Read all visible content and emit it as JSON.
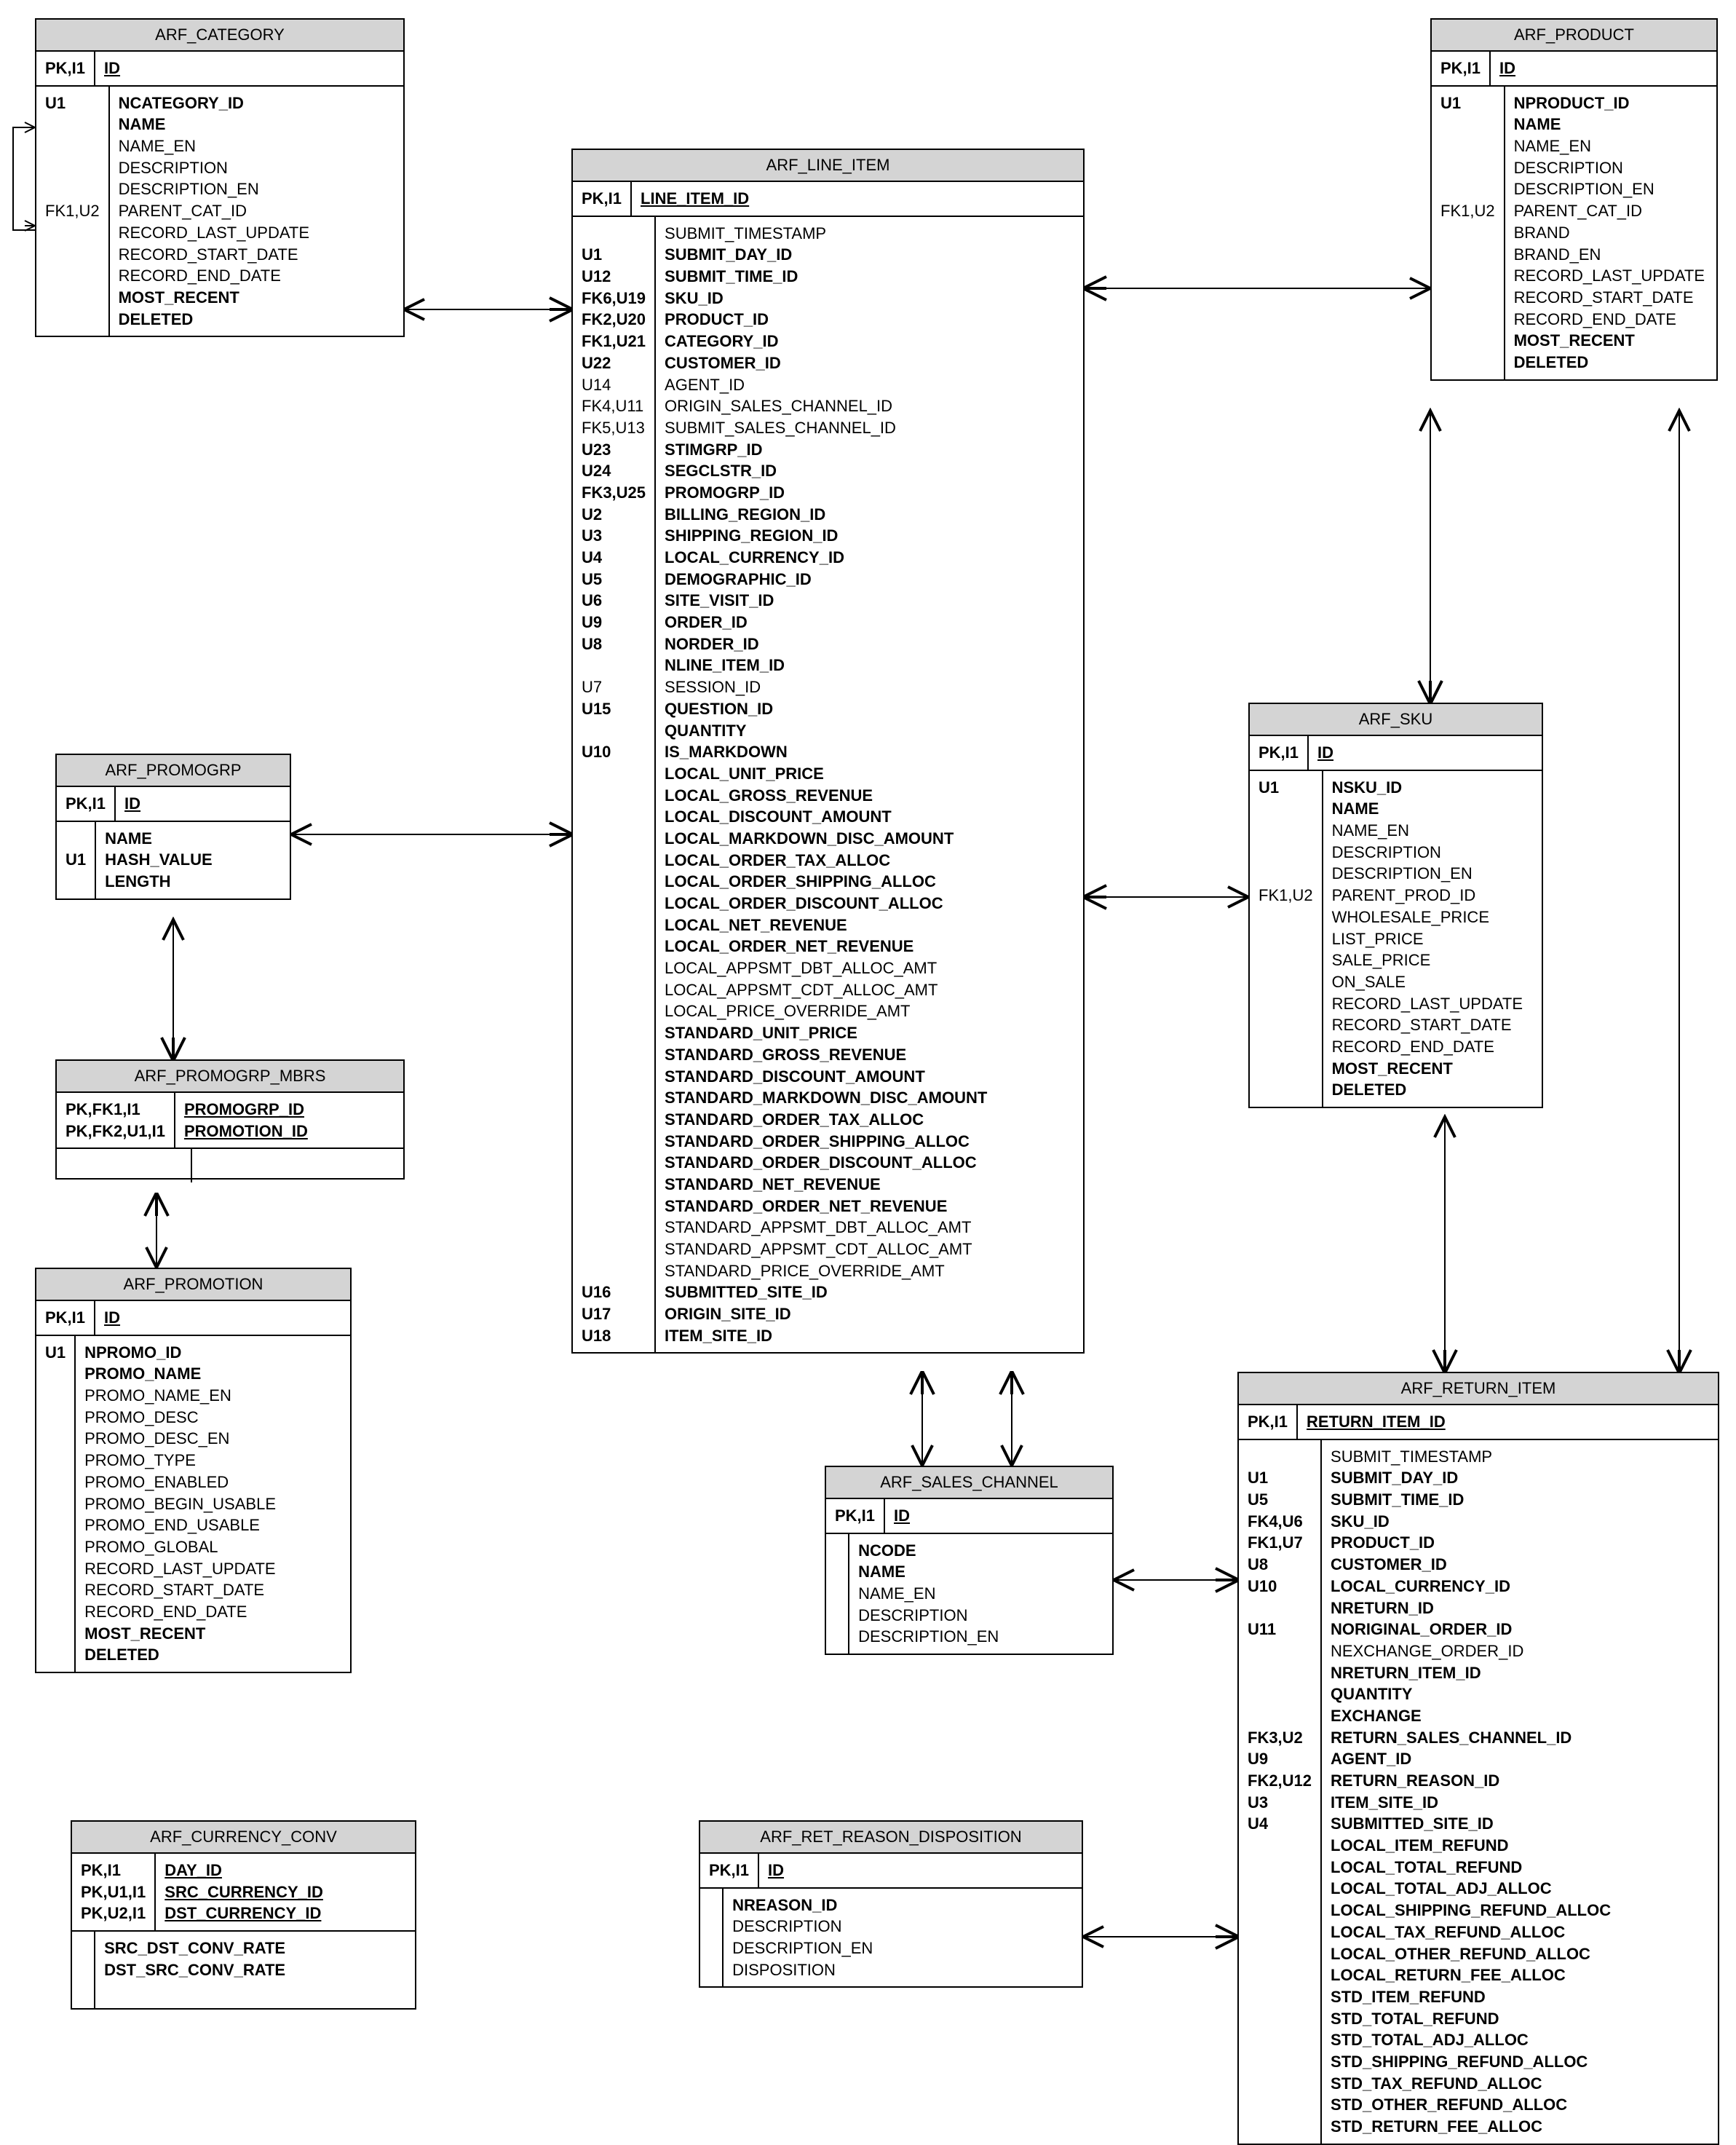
{
  "entities": {
    "arf_category": {
      "title": "ARF_CATEGORY",
      "pk": {
        "key": "PK,I1",
        "name": "ID"
      },
      "attrs": [
        {
          "key": "U1",
          "name": "NCATEGORY_ID",
          "bold": true
        },
        {
          "key": "",
          "name": "NAME",
          "bold": true
        },
        {
          "key": "",
          "name": "NAME_EN"
        },
        {
          "key": "",
          "name": "DESCRIPTION"
        },
        {
          "key": "",
          "name": "DESCRIPTION_EN"
        },
        {
          "key": "FK1,U2",
          "keylight": true,
          "name": "PARENT_CAT_ID"
        },
        {
          "key": "",
          "name": "RECORD_LAST_UPDATE"
        },
        {
          "key": "",
          "name": "RECORD_START_DATE"
        },
        {
          "key": "",
          "name": "RECORD_END_DATE"
        },
        {
          "key": "",
          "name": "MOST_RECENT",
          "bold": true
        },
        {
          "key": "",
          "name": "DELETED",
          "bold": true
        }
      ]
    },
    "arf_product": {
      "title": "ARF_PRODUCT",
      "pk": {
        "key": "PK,I1",
        "name": "ID"
      },
      "attrs": [
        {
          "key": "U1",
          "name": "NPRODUCT_ID",
          "bold": true
        },
        {
          "key": "",
          "name": "NAME",
          "bold": true
        },
        {
          "key": "",
          "name": "NAME_EN"
        },
        {
          "key": "",
          "name": "DESCRIPTION"
        },
        {
          "key": "",
          "name": "DESCRIPTION_EN"
        },
        {
          "key": "FK1,U2",
          "keylight": true,
          "name": "PARENT_CAT_ID"
        },
        {
          "key": "",
          "name": "BRAND"
        },
        {
          "key": "",
          "name": "BRAND_EN"
        },
        {
          "key": "",
          "name": "RECORD_LAST_UPDATE"
        },
        {
          "key": "",
          "name": "RECORD_START_DATE"
        },
        {
          "key": "",
          "name": "RECORD_END_DATE"
        },
        {
          "key": "",
          "name": "MOST_RECENT",
          "bold": true
        },
        {
          "key": "",
          "name": "DELETED",
          "bold": true
        }
      ]
    },
    "arf_line_item": {
      "title": "ARF_LINE_ITEM",
      "pk": {
        "key": "PK,I1",
        "name": "LINE_ITEM_ID"
      },
      "attrs": [
        {
          "key": "",
          "name": "SUBMIT_TIMESTAMP"
        },
        {
          "key": "U1",
          "name": "SUBMIT_DAY_ID",
          "bold": true
        },
        {
          "key": "U12",
          "name": "SUBMIT_TIME_ID",
          "bold": true
        },
        {
          "key": "FK6,U19",
          "name": "SKU_ID",
          "bold": true
        },
        {
          "key": "FK2,U20",
          "name": "PRODUCT_ID",
          "bold": true
        },
        {
          "key": "FK1,U21",
          "name": "CATEGORY_ID",
          "bold": true
        },
        {
          "key": "U22",
          "name": "CUSTOMER_ID",
          "bold": true
        },
        {
          "key": "U14",
          "keylight": true,
          "name": "AGENT_ID"
        },
        {
          "key": "FK4,U11",
          "keylight": true,
          "name": "ORIGIN_SALES_CHANNEL_ID"
        },
        {
          "key": "FK5,U13",
          "keylight": true,
          "name": "SUBMIT_SALES_CHANNEL_ID"
        },
        {
          "key": "U23",
          "name": "STIMGRP_ID",
          "bold": true
        },
        {
          "key": "U24",
          "name": "SEGCLSTR_ID",
          "bold": true
        },
        {
          "key": "FK3,U25",
          "name": "PROMOGRP_ID",
          "bold": true
        },
        {
          "key": "U2",
          "name": "BILLING_REGION_ID",
          "bold": true
        },
        {
          "key": "U3",
          "name": "SHIPPING_REGION_ID",
          "bold": true
        },
        {
          "key": "U4",
          "name": "LOCAL_CURRENCY_ID",
          "bold": true
        },
        {
          "key": "U5",
          "name": "DEMOGRAPHIC_ID",
          "bold": true
        },
        {
          "key": "U6",
          "name": "SITE_VISIT_ID",
          "bold": true
        },
        {
          "key": "U9",
          "name": "ORDER_ID",
          "bold": true
        },
        {
          "key": "U8",
          "name": "NORDER_ID",
          "bold": true
        },
        {
          "key": "",
          "name": "NLINE_ITEM_ID",
          "bold": true
        },
        {
          "key": "U7",
          "keylight": true,
          "name": "SESSION_ID"
        },
        {
          "key": "U15",
          "name": "QUESTION_ID",
          "bold": true
        },
        {
          "key": "",
          "name": "QUANTITY",
          "bold": true
        },
        {
          "key": "U10",
          "name": "IS_MARKDOWN",
          "bold": true
        },
        {
          "key": "",
          "name": "LOCAL_UNIT_PRICE",
          "bold": true
        },
        {
          "key": "",
          "name": "LOCAL_GROSS_REVENUE",
          "bold": true
        },
        {
          "key": "",
          "name": "LOCAL_DISCOUNT_AMOUNT",
          "bold": true
        },
        {
          "key": "",
          "name": "LOCAL_MARKDOWN_DISC_AMOUNT",
          "bold": true
        },
        {
          "key": "",
          "name": "LOCAL_ORDER_TAX_ALLOC",
          "bold": true
        },
        {
          "key": "",
          "name": "LOCAL_ORDER_SHIPPING_ALLOC",
          "bold": true
        },
        {
          "key": "",
          "name": "LOCAL_ORDER_DISCOUNT_ALLOC",
          "bold": true
        },
        {
          "key": "",
          "name": "LOCAL_NET_REVENUE",
          "bold": true
        },
        {
          "key": "",
          "name": "LOCAL_ORDER_NET_REVENUE",
          "bold": true
        },
        {
          "key": "",
          "name": "LOCAL_APPSMT_DBT_ALLOC_AMT"
        },
        {
          "key": "",
          "name": "LOCAL_APPSMT_CDT_ALLOC_AMT"
        },
        {
          "key": "",
          "name": "LOCAL_PRICE_OVERRIDE_AMT"
        },
        {
          "key": "",
          "name": "STANDARD_UNIT_PRICE",
          "bold": true
        },
        {
          "key": "",
          "name": "STANDARD_GROSS_REVENUE",
          "bold": true
        },
        {
          "key": "",
          "name": "STANDARD_DISCOUNT_AMOUNT",
          "bold": true
        },
        {
          "key": "",
          "name": "STANDARD_MARKDOWN_DISC_AMOUNT",
          "bold": true
        },
        {
          "key": "",
          "name": "STANDARD_ORDER_TAX_ALLOC",
          "bold": true
        },
        {
          "key": "",
          "name": "STANDARD_ORDER_SHIPPING_ALLOC",
          "bold": true
        },
        {
          "key": "",
          "name": "STANDARD_ORDER_DISCOUNT_ALLOC",
          "bold": true
        },
        {
          "key": "",
          "name": "STANDARD_NET_REVENUE",
          "bold": true
        },
        {
          "key": "",
          "name": "STANDARD_ORDER_NET_REVENUE",
          "bold": true
        },
        {
          "key": "",
          "name": "STANDARD_APPSMT_DBT_ALLOC_AMT"
        },
        {
          "key": "",
          "name": "STANDARD_APPSMT_CDT_ALLOC_AMT"
        },
        {
          "key": "",
          "name": "STANDARD_PRICE_OVERRIDE_AMT"
        },
        {
          "key": "U16",
          "name": "SUBMITTED_SITE_ID",
          "bold": true
        },
        {
          "key": "U17",
          "name": "ORIGIN_SITE_ID",
          "bold": true
        },
        {
          "key": "U18",
          "name": "ITEM_SITE_ID",
          "bold": true
        }
      ]
    },
    "arf_sku": {
      "title": "ARF_SKU",
      "pk": {
        "key": "PK,I1",
        "name": "ID"
      },
      "attrs": [
        {
          "key": "U1",
          "name": "NSKU_ID",
          "bold": true
        },
        {
          "key": "",
          "name": "NAME",
          "bold": true
        },
        {
          "key": "",
          "name": "NAME_EN"
        },
        {
          "key": "",
          "name": "DESCRIPTION"
        },
        {
          "key": "",
          "name": "DESCRIPTION_EN"
        },
        {
          "key": "FK1,U2",
          "keylight": true,
          "name": "PARENT_PROD_ID"
        },
        {
          "key": "",
          "name": "WHOLESALE_PRICE"
        },
        {
          "key": "",
          "name": "LIST_PRICE"
        },
        {
          "key": "",
          "name": "SALE_PRICE"
        },
        {
          "key": "",
          "name": "ON_SALE"
        },
        {
          "key": "",
          "name": "RECORD_LAST_UPDATE"
        },
        {
          "key": "",
          "name": "RECORD_START_DATE"
        },
        {
          "key": "",
          "name": "RECORD_END_DATE"
        },
        {
          "key": "",
          "name": "MOST_RECENT",
          "bold": true
        },
        {
          "key": "",
          "name": "DELETED",
          "bold": true
        }
      ]
    },
    "arf_promogrp": {
      "title": "ARF_PROMOGRP",
      "pk": {
        "key": "PK,I1",
        "name": "ID"
      },
      "attrs": [
        {
          "key": "",
          "name": "NAME",
          "bold": true
        },
        {
          "key": "U1",
          "name": "HASH_VALUE",
          "bold": true
        },
        {
          "key": "",
          "name": "LENGTH",
          "bold": true
        }
      ]
    },
    "arf_promogrp_mbrs": {
      "title": "ARF_PROMOGRP_MBRS",
      "pks": [
        {
          "key": "PK,FK1,I1",
          "name": "PROMOGRP_ID"
        },
        {
          "key": "PK,FK2,U1,I1",
          "name": "PROMOTION_ID"
        }
      ]
    },
    "arf_promotion": {
      "title": "ARF_PROMOTION",
      "pk": {
        "key": "PK,I1",
        "name": "ID"
      },
      "attrs": [
        {
          "key": "U1",
          "name": "NPROMO_ID",
          "bold": true
        },
        {
          "key": "",
          "name": "PROMO_NAME",
          "bold": true
        },
        {
          "key": "",
          "name": "PROMO_NAME_EN"
        },
        {
          "key": "",
          "name": "PROMO_DESC"
        },
        {
          "key": "",
          "name": "PROMO_DESC_EN"
        },
        {
          "key": "",
          "name": "PROMO_TYPE"
        },
        {
          "key": "",
          "name": "PROMO_ENABLED"
        },
        {
          "key": "",
          "name": "PROMO_BEGIN_USABLE"
        },
        {
          "key": "",
          "name": "PROMO_END_USABLE"
        },
        {
          "key": "",
          "name": "PROMO_GLOBAL"
        },
        {
          "key": "",
          "name": "RECORD_LAST_UPDATE"
        },
        {
          "key": "",
          "name": "RECORD_START_DATE"
        },
        {
          "key": "",
          "name": "RECORD_END_DATE"
        },
        {
          "key": "",
          "name": "MOST_RECENT",
          "bold": true
        },
        {
          "key": "",
          "name": "DELETED",
          "bold": true
        }
      ]
    },
    "arf_sales_channel": {
      "title": "ARF_SALES_CHANNEL",
      "pk": {
        "key": "PK,I1",
        "name": "ID"
      },
      "attrs": [
        {
          "key": "",
          "name": "NCODE",
          "bold": true
        },
        {
          "key": "",
          "name": "NAME",
          "bold": true
        },
        {
          "key": "",
          "name": "NAME_EN"
        },
        {
          "key": "",
          "name": "DESCRIPTION"
        },
        {
          "key": "",
          "name": "DESCRIPTION_EN"
        }
      ]
    },
    "arf_return_item": {
      "title": "ARF_RETURN_ITEM",
      "pk": {
        "key": "PK,I1",
        "name": "RETURN_ITEM_ID"
      },
      "attrs": [
        {
          "key": "",
          "name": "SUBMIT_TIMESTAMP"
        },
        {
          "key": "U1",
          "name": "SUBMIT_DAY_ID",
          "bold": true
        },
        {
          "key": "U5",
          "name": "SUBMIT_TIME_ID",
          "bold": true
        },
        {
          "key": "FK4,U6",
          "name": "SKU_ID",
          "bold": true
        },
        {
          "key": "FK1,U7",
          "name": "PRODUCT_ID",
          "bold": true
        },
        {
          "key": "U8",
          "name": "CUSTOMER_ID",
          "bold": true
        },
        {
          "key": "U10",
          "name": "LOCAL_CURRENCY_ID",
          "bold": true
        },
        {
          "key": "",
          "name": "NRETURN_ID",
          "bold": true
        },
        {
          "key": "U11",
          "name": "NORIGINAL_ORDER_ID",
          "bold": true
        },
        {
          "key": "",
          "name": "NEXCHANGE_ORDER_ID"
        },
        {
          "key": "",
          "name": "NRETURN_ITEM_ID",
          "bold": true
        },
        {
          "key": "",
          "name": "QUANTITY",
          "bold": true
        },
        {
          "key": "",
          "name": "EXCHANGE",
          "bold": true
        },
        {
          "key": "FK3,U2",
          "name": "RETURN_SALES_CHANNEL_ID",
          "bold": true
        },
        {
          "key": "U9",
          "name": "AGENT_ID",
          "bold": true
        },
        {
          "key": "FK2,U12",
          "name": "RETURN_REASON_ID",
          "bold": true
        },
        {
          "key": "U3",
          "name": "ITEM_SITE_ID",
          "bold": true
        },
        {
          "key": "U4",
          "name": "SUBMITTED_SITE_ID",
          "bold": true
        },
        {
          "key": "",
          "name": "LOCAL_ITEM_REFUND",
          "bold": true
        },
        {
          "key": "",
          "name": "LOCAL_TOTAL_REFUND",
          "bold": true
        },
        {
          "key": "",
          "name": "LOCAL_TOTAL_ADJ_ALLOC",
          "bold": true
        },
        {
          "key": "",
          "name": "LOCAL_SHIPPING_REFUND_ALLOC",
          "bold": true
        },
        {
          "key": "",
          "name": "LOCAL_TAX_REFUND_ALLOC",
          "bold": true
        },
        {
          "key": "",
          "name": "LOCAL_OTHER_REFUND_ALLOC",
          "bold": true
        },
        {
          "key": "",
          "name": "LOCAL_RETURN_FEE_ALLOC",
          "bold": true
        },
        {
          "key": "",
          "name": "STD_ITEM_REFUND",
          "bold": true
        },
        {
          "key": "",
          "name": "STD_TOTAL_REFUND",
          "bold": true
        },
        {
          "key": "",
          "name": "STD_TOTAL_ADJ_ALLOC",
          "bold": true
        },
        {
          "key": "",
          "name": "STD_SHIPPING_REFUND_ALLOC",
          "bold": true
        },
        {
          "key": "",
          "name": "STD_TAX_REFUND_ALLOC",
          "bold": true
        },
        {
          "key": "",
          "name": "STD_OTHER_REFUND_ALLOC",
          "bold": true
        },
        {
          "key": "",
          "name": "STD_RETURN_FEE_ALLOC",
          "bold": true
        }
      ]
    },
    "arf_currency_conv": {
      "title": "ARF_CURRENCY_CONV",
      "pks": [
        {
          "key": "PK,I1",
          "name": "DAY_ID"
        },
        {
          "key": "PK,U1,I1",
          "name": "SRC_CURRENCY_ID"
        },
        {
          "key": "PK,U2,I1",
          "name": "DST_CURRENCY_ID"
        }
      ],
      "attrs": [
        {
          "key": "",
          "name": "SRC_DST_CONV_RATE",
          "bold": true
        },
        {
          "key": "",
          "name": "DST_SRC_CONV_RATE",
          "bold": true
        }
      ]
    },
    "arf_ret_reason_disposition": {
      "title": "ARF_RET_REASON_DISPOSITION",
      "pk": {
        "key": "PK,I1",
        "name": "ID"
      },
      "attrs": [
        {
          "key": "",
          "name": "NREASON_ID",
          "bold": true
        },
        {
          "key": "",
          "name": "DESCRIPTION"
        },
        {
          "key": "",
          "name": "DESCRIPTION_EN"
        },
        {
          "key": "",
          "name": "DISPOSITION"
        }
      ]
    }
  }
}
